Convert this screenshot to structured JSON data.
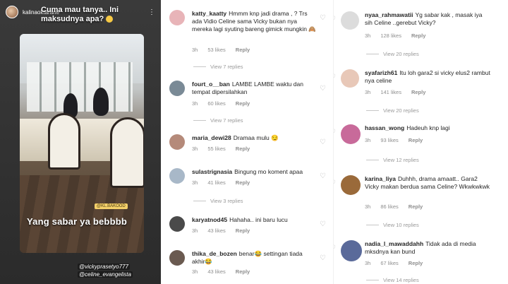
{
  "story": {
    "username": "kalinaoktarane",
    "question": "Cuma mau tanya.. Ini maksudnya apa?",
    "tag": "@KL.BAKOOD",
    "caption": "Yang sabar ya bebbbb",
    "mentions": [
      "@vickyprasetyo777",
      "@celine_evangelista"
    ]
  },
  "left_comments": [
    {
      "user": "katty_kaatty",
      "text": "Hmmm knp jadi drama , ? Trs ada Vidio Celine sama Vicky bukan nya mereka lagi syuting bareng gimick mungkin 🙈",
      "time": "3h",
      "likes": "53 likes",
      "reply": "Reply",
      "view_replies": "View 7 replies",
      "avatar": "#e8b4b8"
    },
    {
      "user": "fourt_o__ban",
      "text": "LAMBE LAMBE waktu dan tempat dipersilahkan",
      "time": "3h",
      "likes": "60 likes",
      "reply": "Reply",
      "view_replies": "View 7 replies",
      "avatar": "#7a8a96"
    },
    {
      "user": "maria_dewi28",
      "text": "Dramaa mulu 😏",
      "time": "3h",
      "likes": "55 likes",
      "reply": "Reply",
      "view_replies": "",
      "avatar": "#b58a7a"
    },
    {
      "user": "sulastrignasia",
      "text": "Bingung mo koment apaa",
      "time": "3h",
      "likes": "41 likes",
      "reply": "Reply",
      "view_replies": "View 3 replies",
      "avatar": "#a8b8c8"
    },
    {
      "user": "karyatnod45",
      "text": "Hahaha.. ini baru lucu",
      "time": "3h",
      "likes": "43 likes",
      "reply": "Reply",
      "view_replies": "",
      "avatar": "#4a4a4a"
    },
    {
      "user": "thika_de_bozen",
      "text": "benar😂 settingan tiada akhir😂",
      "time": "3h",
      "likes": "43 likes",
      "reply": "Reply",
      "view_replies": "",
      "avatar": "#6a5a50"
    }
  ],
  "right_comments": [
    {
      "user": "nyaa_rahmawatii",
      "text": "Yg sabar kak , masak iya sih Celine ..gerebut Vicky?",
      "time": "3h",
      "likes": "128 likes",
      "reply": "Reply",
      "view_replies": "View 20 replies",
      "avatar": "#dcdcdc"
    },
    {
      "user": "syafarizh61",
      "text": "Itu loh gara2 si vicky elus2 rambut nya celine",
      "time": "3h",
      "likes": "141 likes",
      "reply": "Reply",
      "view_replies": "View 20 replies",
      "avatar": "#e8c8b8"
    },
    {
      "user": "hassan_wong",
      "text": "Hadeuh knp lagi",
      "time": "3h",
      "likes": "93 likes",
      "reply": "Reply",
      "view_replies": "View 12 replies",
      "avatar": "#c86a9a"
    },
    {
      "user": "karina_liya",
      "text": "Duhhh, drama amaatt.. Gara2 Vicky makan berdua sama Celine? Wkwkwkwk",
      "time": "3h",
      "likes": "86 likes",
      "reply": "Reply",
      "view_replies": "View 10 replies",
      "avatar": "#9a6a3a"
    },
    {
      "user": "nadia_l_mawaddahh",
      "text": "Tidak ada di media mksdnya kan bund",
      "time": "3h",
      "likes": "67 likes",
      "reply": "Reply",
      "view_replies": "View 14 replies",
      "avatar": "#5a6a9a"
    }
  ],
  "icons": {
    "heart": "heart-outline-icon",
    "more": "more-vertical-icon"
  }
}
